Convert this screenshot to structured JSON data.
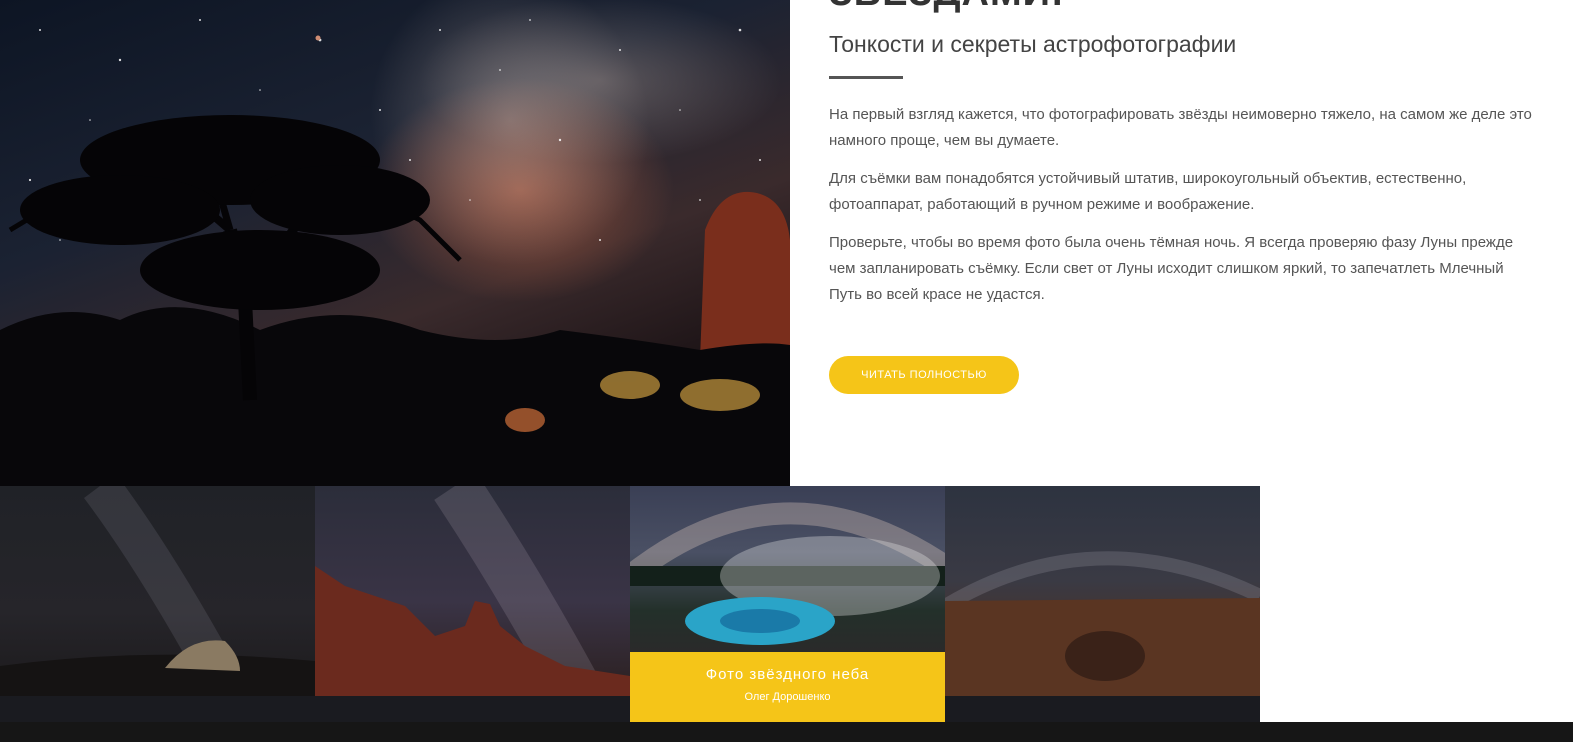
{
  "colors": {
    "accent": "#f5c518",
    "heading": "#333333",
    "body_text": "#555555",
    "gallery_bg": "#1a1b20",
    "footer_bg": "#161616"
  },
  "article": {
    "headline": "ЗВЁЗДАМИ!",
    "subtitle": "Тонкости и секреты астрофотографии",
    "paragraphs": [
      "На первый взгляд кажется, что фотографировать звёзды неимоверно тяжело, на самом же деле это намного проще, чем вы думаете.",
      "Для съёмки вам понадобятся устойчивый штатив, широкоугольный объектив, естественно, фотоаппарат, работающий в ручном режиме и воображение.",
      "Проверьте, чтобы во время фото была очень тёмная ночь. Я всегда проверяю фазу Луны прежде чем запланировать съёмку. Если свет от Луны исходит слишком яркий, то запечатлеть Млечный Путь во всей красе не удастся."
    ],
    "read_more_label": "ЧИТАТЬ ПОЛНОСТЬЮ"
  },
  "gallery": {
    "featured_caption": {
      "title": "Фото звёздного неба",
      "author": "Олег Дорошенко"
    }
  }
}
